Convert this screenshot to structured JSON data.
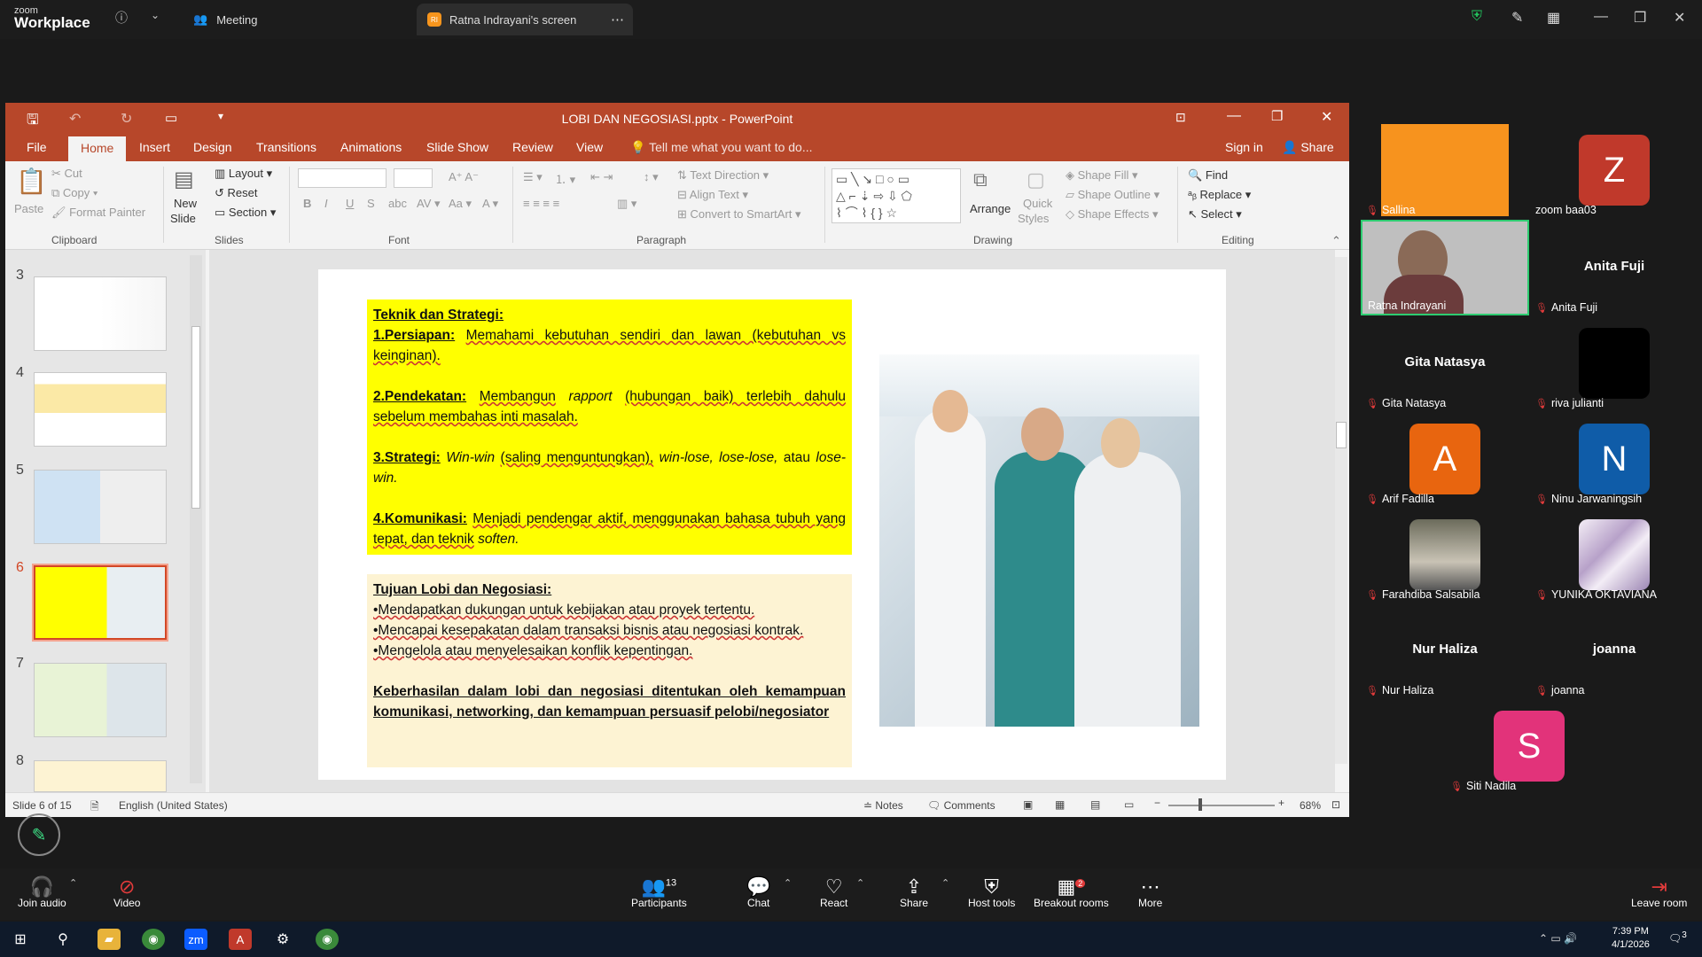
{
  "zoom": {
    "brand_small": "zoom",
    "brand_large": "Workplace",
    "meeting_tab": "Meeting",
    "share_tab": "Ratna Indrayani's screen",
    "share_badge": "RI"
  },
  "ppt": {
    "window_title": "LOBI DAN NEGOSIASI.pptx - PowerPoint",
    "tabs": [
      "File",
      "Home",
      "Insert",
      "Design",
      "Transitions",
      "Animations",
      "Slide Show",
      "Review",
      "View"
    ],
    "tell_me": "Tell me what you want to do...",
    "sign_in": "Sign in",
    "share": "Share",
    "ribbon": {
      "clipboard": {
        "paste": "Paste",
        "cut": "Cut",
        "copy": "Copy",
        "format_painter": "Format Painter",
        "label": "Clipboard"
      },
      "slides": {
        "new_slide": "New",
        "new_slide2": "Slide",
        "layout": "Layout",
        "reset": "Reset",
        "section": "Section",
        "label": "Slides"
      },
      "font": {
        "label": "Font"
      },
      "paragraph": {
        "text_direction": "Text Direction",
        "align_text": "Align Text",
        "convert": "Convert to SmartArt",
        "label": "Paragraph"
      },
      "drawing": {
        "arrange": "Arrange",
        "quick_styles": "Quick",
        "quick_styles2": "Styles",
        "shape_fill": "Shape Fill",
        "shape_outline": "Shape Outline",
        "shape_effects": "Shape Effects",
        "label": "Drawing"
      },
      "editing": {
        "find": "Find",
        "replace": "Replace",
        "select": "Select",
        "label": "Editing"
      }
    },
    "thumb_numbers": [
      "3",
      "4",
      "5",
      "6",
      "7",
      "8"
    ],
    "slide": {
      "box1": {
        "heading": "Teknik dan Strategi:",
        "p1_label": "1.Persiapan:",
        "p1_text": "Memahami kebutuhan sendiri dan lawan (kebutuhan vs keinginan).",
        "p2_label": "2.Pendekatan:",
        "p2_text_a": "Membangun",
        "p2_text_b": "rapport",
        "p2_text_c": "(hubungan baik) terlebih dahulu sebelum membahas inti masalah.",
        "p3_label": "3.Strategi:",
        "p3_text_a": "Win-win",
        "p3_text_b": "(saling menguntungkan),",
        "p3_text_c": "win-lose, lose-lose,",
        "p3_text_d": "atau",
        "p3_text_e": "lose-win.",
        "p4_label": "4.Komunikasi:",
        "p4_text_a": "Menjadi pendengar aktif, menggunakan bahasa tubuh yang tepat, dan teknik",
        "p4_text_b": "soften."
      },
      "box2": {
        "heading": "Tujuan Lobi dan Negosiasi:",
        "b1": "•Mendapatkan dukungan untuk kebijakan atau proyek tertentu.",
        "b2": "•Mencapai kesepakatan dalam transaksi bisnis atau negosiasi kontrak.",
        "b3": "•Mengelola atau menyelesaikan konflik kepentingan.",
        "conclusion": "Keberhasilan dalam lobi dan negosiasi ditentukan oleh kemampuan komunikasi, networking, dan kemampuan persuasif pelobi/negosiator"
      }
    },
    "status": {
      "slide": "Slide 6 of 15",
      "language": "English (United States)",
      "notes": "Notes",
      "comments": "Comments",
      "zoom": "68%"
    }
  },
  "participants": [
    {
      "name": "Sallina",
      "type": "orange"
    },
    {
      "name": "zoom baa03",
      "initial": "Z",
      "color": "#c0392b"
    },
    {
      "name": "Ratna Indrayani",
      "type": "video"
    },
    {
      "name": "Anita Fuji",
      "type": "text"
    },
    {
      "name": "Gita Natasya",
      "type": "text"
    },
    {
      "name": "riva julianti",
      "type": "black"
    },
    {
      "name": "Arif Fadilla",
      "initial": "A",
      "color": "#e8650f"
    },
    {
      "name": "Ninu Jarwaningsih",
      "initial": "N",
      "color": "#0f5ca8"
    },
    {
      "name": "Farahdiba Salsabila",
      "type": "photo"
    },
    {
      "name": "YUNIKA OKTAVIANA",
      "type": "marble"
    },
    {
      "name": "Nur Haliza",
      "type": "text"
    },
    {
      "name": "joanna",
      "type": "text"
    },
    {
      "name": "Siti Nadila",
      "initial": "S",
      "color": "#e2337a"
    }
  ],
  "toolbar": {
    "join_audio": "Join audio",
    "video": "Video",
    "participants": "Participants",
    "participants_count": "13",
    "chat": "Chat",
    "react": "React",
    "share": "Share",
    "host_tools": "Host tools",
    "breakout": "Breakout rooms",
    "breakout_badge": "2",
    "more": "More",
    "leave": "Leave room"
  },
  "taskbar": {
    "time": "7:39 PM",
    "date": "4/1/2026",
    "notif": "3"
  },
  "colors": {
    "ppt_accent": "#b7472a",
    "zoom_bg": "#1c1c1c"
  }
}
